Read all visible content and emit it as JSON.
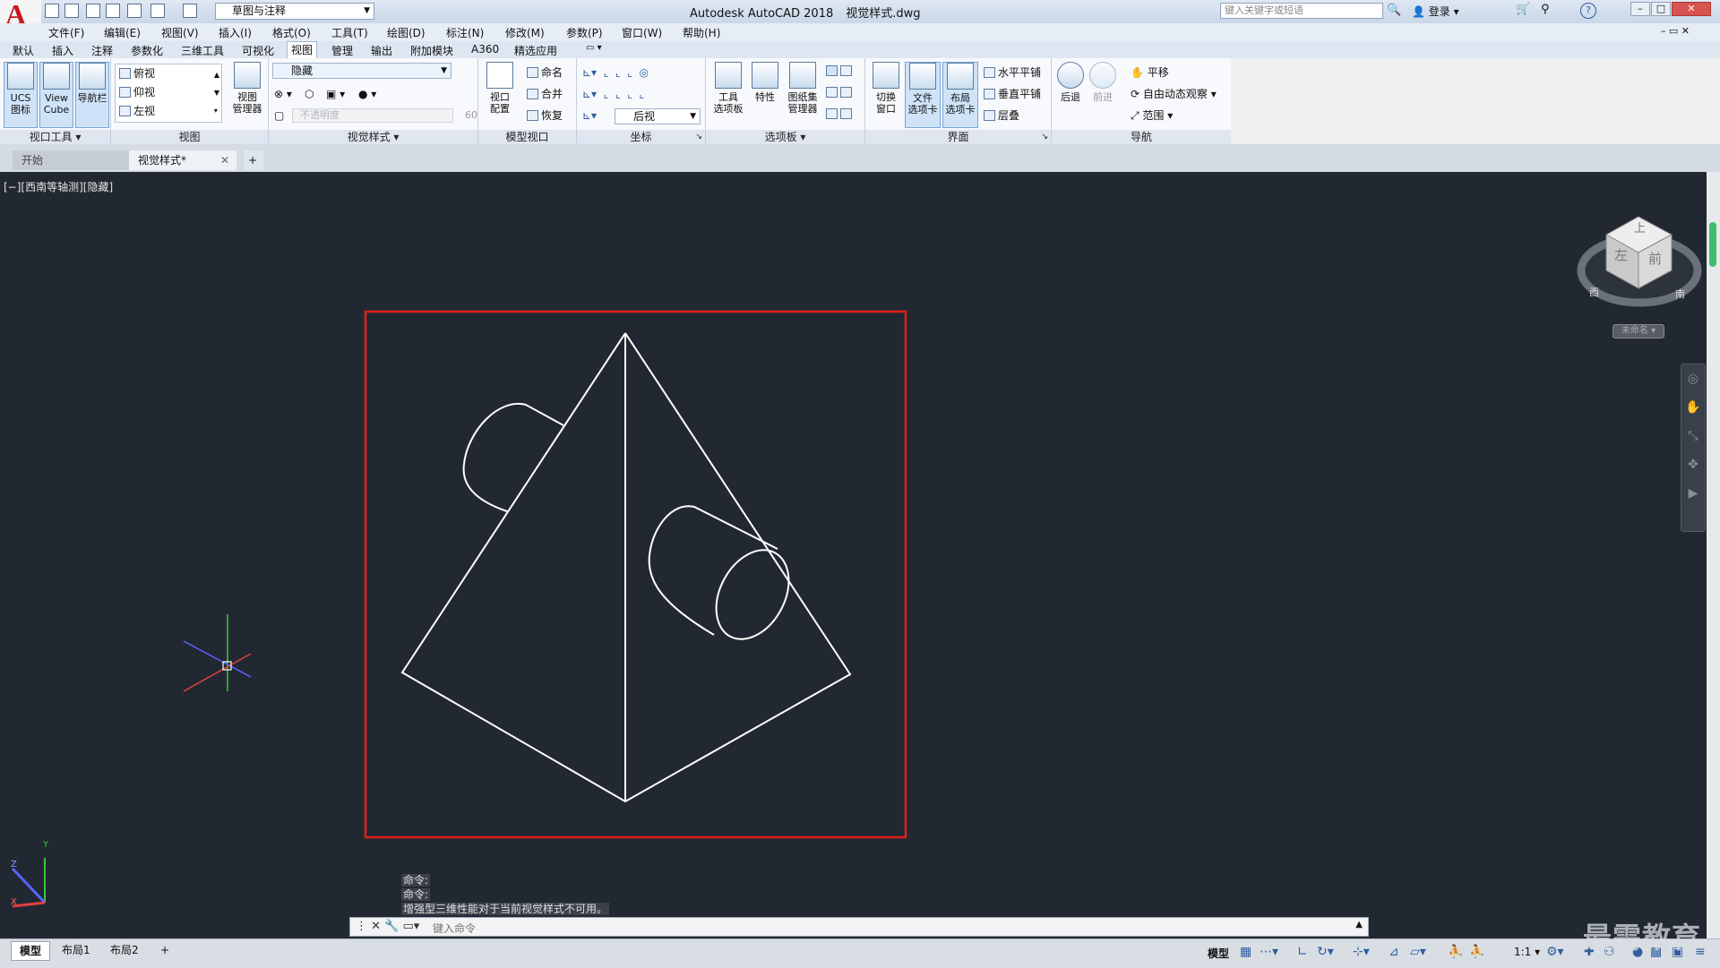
{
  "title_bar": {
    "app_name": "Autodesk AutoCAD 2018",
    "file_name": "视觉样式.dwg",
    "workspace": "草图与注释",
    "search_placeholder": "键入关键字或短语",
    "login_label": "登录",
    "help_label": "?"
  },
  "menu": [
    "文件(F)",
    "编辑(E)",
    "视图(V)",
    "插入(I)",
    "格式(O)",
    "工具(T)",
    "绘图(D)",
    "标注(N)",
    "修改(M)",
    "参数(P)",
    "窗口(W)",
    "帮助(H)"
  ],
  "ribbon_tabs": [
    "默认",
    "插入",
    "注释",
    "参数化",
    "三维工具",
    "可视化",
    "视图",
    "管理",
    "输出",
    "附加模块",
    "A360",
    "精选应用"
  ],
  "active_ribbon_tab": "视图",
  "ribbon": {
    "viewport_tools": {
      "title": "视口工具",
      "ucs_line1": "UCS",
      "ucs_line2": "图标",
      "viewcube_line1": "View",
      "viewcube_line2": "Cube",
      "navbar": "导航栏"
    },
    "views": {
      "title": "视图",
      "items": [
        "俯视",
        "仰视",
        "左视"
      ],
      "manager_line1": "视图",
      "manager_line2": "管理器"
    },
    "visual_styles": {
      "title": "视觉样式",
      "current": "隐藏",
      "opacity_label": "不透明度",
      "opacity_value": "60"
    },
    "model_viewports": {
      "title": "模型视口",
      "config_line1": "视口",
      "config_line2": "配置",
      "named": "命名",
      "join": "合并",
      "restore": "恢复"
    },
    "coordinates": {
      "title": "坐标",
      "view_combo": "后视"
    },
    "palettes": {
      "title": "选项板",
      "tool_line1": "工具",
      "tool_line2": "选项板",
      "properties": "特性",
      "sheetset_line1": "图纸集",
      "sheetset_line2": "管理器"
    },
    "interface": {
      "title": "界面",
      "switch_line1": "切换",
      "switch_line2": "窗口",
      "filetab_line1": "文件",
      "filetab_line2": "选项卡",
      "layouttab_line1": "布局",
      "layouttab_line2": "选项卡",
      "tile_h": "水平平铺",
      "tile_v": "垂直平铺",
      "cascade": "层叠"
    },
    "navigate": {
      "title": "导航",
      "back": "后退",
      "forward": "前进",
      "pan": "平移",
      "orbit": "自由动态观察",
      "extents": "范围"
    }
  },
  "file_tabs": {
    "start": "开始",
    "document": "视觉样式*",
    "add": "+"
  },
  "viewport_label": "[−][西南等轴测][隐藏]",
  "viewcube": {
    "top": "上",
    "front": "前",
    "left": "左",
    "west": "西",
    "south": "南",
    "wcs": "未命名"
  },
  "ucs": {
    "x": "X",
    "y": "Y",
    "z": "Z"
  },
  "command_history": [
    "命令:",
    "命令:",
    "增强型三维性能对于当前视觉样式不可用。"
  ],
  "command_placeholder": "键入命令",
  "layout_tabs": [
    "模型",
    "布局1",
    "布局2"
  ],
  "layout_add": "+",
  "status": {
    "model": "模型",
    "scale": "1:1"
  },
  "watermark": "最需教育",
  "colors": {
    "canvas": "#222831",
    "selection_frame": "#e0201a",
    "accent": "#c8161d"
  }
}
